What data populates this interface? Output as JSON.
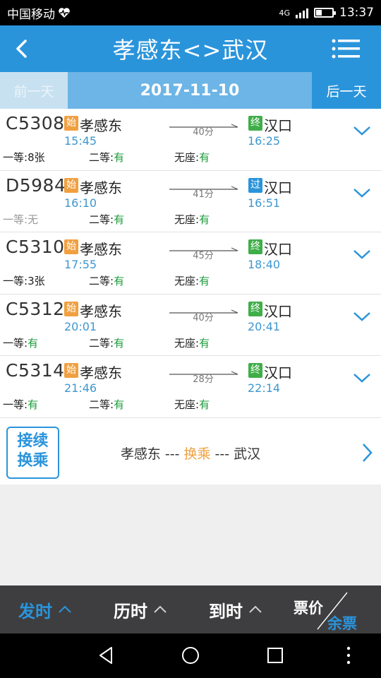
{
  "status_bar": {
    "carrier": "中国移动",
    "time": "13:37",
    "network": "4G"
  },
  "header": {
    "title": "孝感东<>武汉"
  },
  "date_bar": {
    "prev_label": "前一天",
    "date": "2017-11-10",
    "next_label": "后一天"
  },
  "trains": [
    {
      "number": "C5308",
      "start_badge": "始",
      "start_station": "孝感东",
      "depart": "15:45",
      "duration": "40分",
      "end_badge": "终",
      "end_station": "汉口",
      "arrive": "16:25",
      "seat1_label": "一等:",
      "seat1_value": "8张",
      "seat2_label": "二等:",
      "seat2_value": "有",
      "seat3_label": "无座:",
      "seat3_value": "有"
    },
    {
      "number": "D5984",
      "start_badge": "始",
      "start_station": "孝感东",
      "depart": "16:10",
      "duration": "41分",
      "end_badge": "过",
      "end_station": "汉口",
      "arrive": "16:51",
      "seat1_label": "一等:",
      "seat1_value": "无",
      "seat2_label": "二等:",
      "seat2_value": "有",
      "seat3_label": "无座:",
      "seat3_value": "有"
    },
    {
      "number": "C5310",
      "start_badge": "始",
      "start_station": "孝感东",
      "depart": "17:55",
      "duration": "45分",
      "end_badge": "终",
      "end_station": "汉口",
      "arrive": "18:40",
      "seat1_label": "一等:",
      "seat1_value": "3张",
      "seat2_label": "二等:",
      "seat2_value": "有",
      "seat3_label": "无座:",
      "seat3_value": "有"
    },
    {
      "number": "C5312",
      "start_badge": "始",
      "start_station": "孝感东",
      "depart": "20:01",
      "duration": "40分",
      "end_badge": "终",
      "end_station": "汉口",
      "arrive": "20:41",
      "seat1_label": "一等:",
      "seat1_value": "有",
      "seat2_label": "二等:",
      "seat2_value": "有",
      "seat3_label": "无座:",
      "seat3_value": "有"
    },
    {
      "number": "C5314",
      "start_badge": "始",
      "start_station": "孝感东",
      "depart": "21:46",
      "duration": "28分",
      "end_badge": "终",
      "end_station": "汉口",
      "arrive": "22:14",
      "seat1_label": "一等:",
      "seat1_value": "有",
      "seat2_label": "二等:",
      "seat2_value": "有",
      "seat3_label": "无座:",
      "seat3_value": "有"
    }
  ],
  "transfer": {
    "button_line1": "接续",
    "button_line2": "换乘",
    "from": "孝感东",
    "sep1": " --- ",
    "middle": "换乘",
    "sep2": " --- ",
    "to": "武汉"
  },
  "sort_bar": {
    "depart_label": "发时",
    "duration_label": "历时",
    "arrive_label": "到时",
    "price_label": "票价",
    "remaining_label": "余票"
  },
  "colors": {
    "primary": "#2a94db",
    "start_badge": "#f0a040",
    "end_badge_terminal": "#3fae49",
    "end_badge_pass": "#2a94db",
    "available": "#1e9c3c"
  }
}
